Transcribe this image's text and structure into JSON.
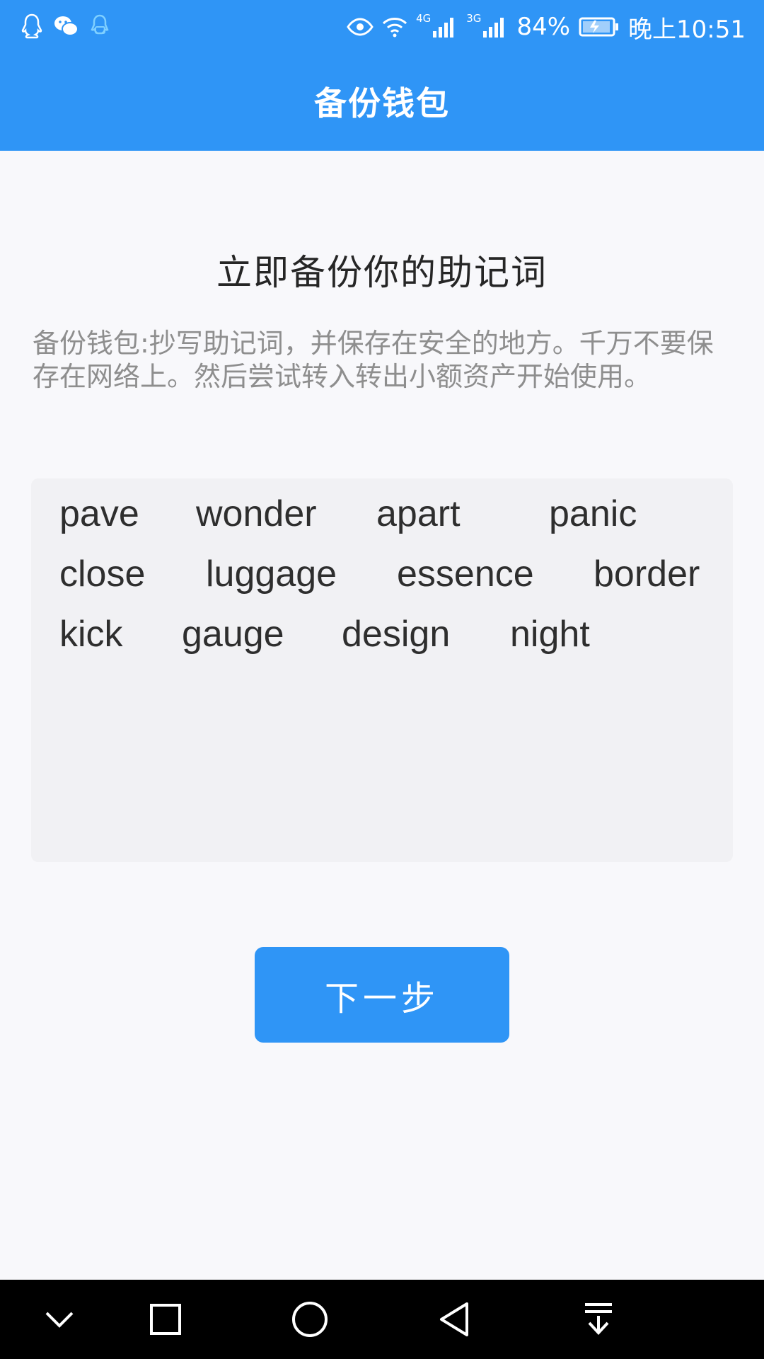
{
  "status_bar": {
    "left_icons": [
      "qq-icon",
      "wechat-icon",
      "qq-robot-icon"
    ],
    "network_4g": "4G",
    "network_3g": "3G",
    "battery_percent": "84%",
    "time": "晚上10:51"
  },
  "header": {
    "title": "备份钱包"
  },
  "main": {
    "heading": "立即备份你的助记词",
    "description": "备份钱包:抄写助记词，并保存在安全的地方。千万不要保存在网络上。然后尝试转入转出小额资产开始使用。",
    "mnemonic_rows": [
      [
        "pave",
        "wonder",
        "apart",
        "panic"
      ],
      [
        "close",
        "luggage",
        "essence",
        "border"
      ],
      [
        "kick",
        "gauge",
        "design",
        "night"
      ]
    ],
    "next_button": "下一步"
  },
  "nav_bar": {
    "icons": [
      "chevron-down-icon",
      "square-icon",
      "circle-icon",
      "back-triangle-icon",
      "notification-pull-icon"
    ]
  },
  "colors": {
    "accent": "#2f95f6",
    "background": "#f8f8fb",
    "box": "#f1f1f4"
  }
}
